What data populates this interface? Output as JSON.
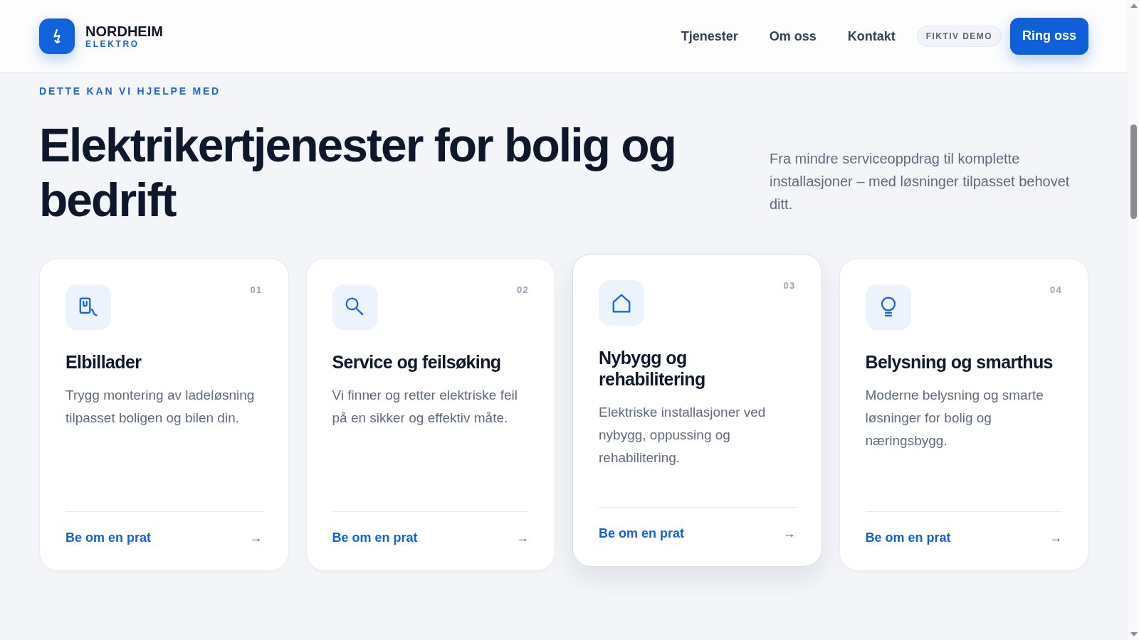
{
  "header": {
    "logo": {
      "name": "NORDHEIM",
      "tagline": "ELEKTRO"
    },
    "nav": [
      "Tjenester",
      "Om oss",
      "Kontakt"
    ],
    "badge": "FIKTIV DEMO",
    "cta": "Ring oss"
  },
  "hero": {
    "eyebrow": "DETTE KAN VI HJELPE MED",
    "title": "Elektrikertjenester for bolig og bedrift",
    "intro": "Fra mindre serviceoppdrag til komplette installasjoner – med løsninger tilpasset behovet ditt."
  },
  "cards": [
    {
      "number": "01",
      "title": "Elbillader",
      "text": "Trygg montering av ladeløsning tilpasset boligen og bilen din.",
      "link": "Be om en prat",
      "arrow": "→",
      "highlighted": false
    },
    {
      "number": "02",
      "title": "Service og feilsøking",
      "text": "Vi finner og retter elektriske feil på en sikker og effektiv måte.",
      "link": "Be om en prat",
      "arrow": "→",
      "highlighted": false
    },
    {
      "number": "03",
      "title": "Nybygg og rehabilitering",
      "text": "Elektriske installasjoner ved nybygg, oppussing og rehabilitering.",
      "link": "Be om en prat",
      "arrow": "→",
      "highlighted": true
    },
    {
      "number": "04",
      "title": "Belysning og smarthus",
      "text": "Moderne belysning og smarte løsninger for bolig og næringsbygg.",
      "link": "Be om en prat",
      "arrow": "→",
      "highlighted": false
    }
  ]
}
